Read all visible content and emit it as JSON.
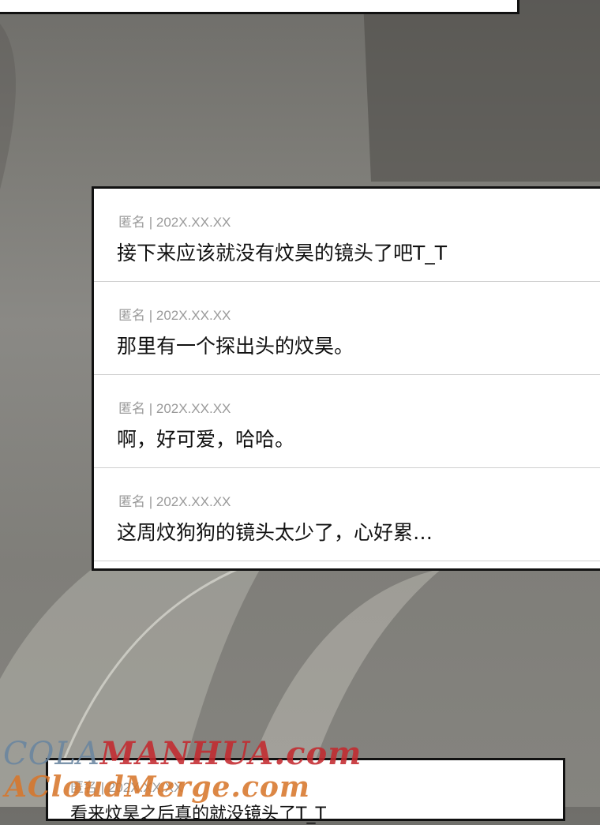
{
  "comments": [
    {
      "meta": "匿名 | 202X.XX.XX",
      "text": "接下来应该就没有炆昊的镜头了吧T_T"
    },
    {
      "meta": "匿名 | 202X.XX.XX",
      "text": "那里有一个探出头的炆昊。"
    },
    {
      "meta": "匿名 | 202X.XX.XX",
      "text": "啊，好可爱，哈哈。"
    },
    {
      "meta": "匿名 | 202X.XX.XX",
      "text": "这周炆狗狗的镜头太少了，心好累…"
    }
  ],
  "bottom_comment": {
    "meta": "匿名 | 202X.XX.XX",
    "text": "看来炆昊之后真的就没镜头了T_T"
  },
  "watermark": {
    "line1_prefix": "COLA",
    "line1_brand": "MANHUA.com",
    "line2": "ACloudMerge.com"
  }
}
